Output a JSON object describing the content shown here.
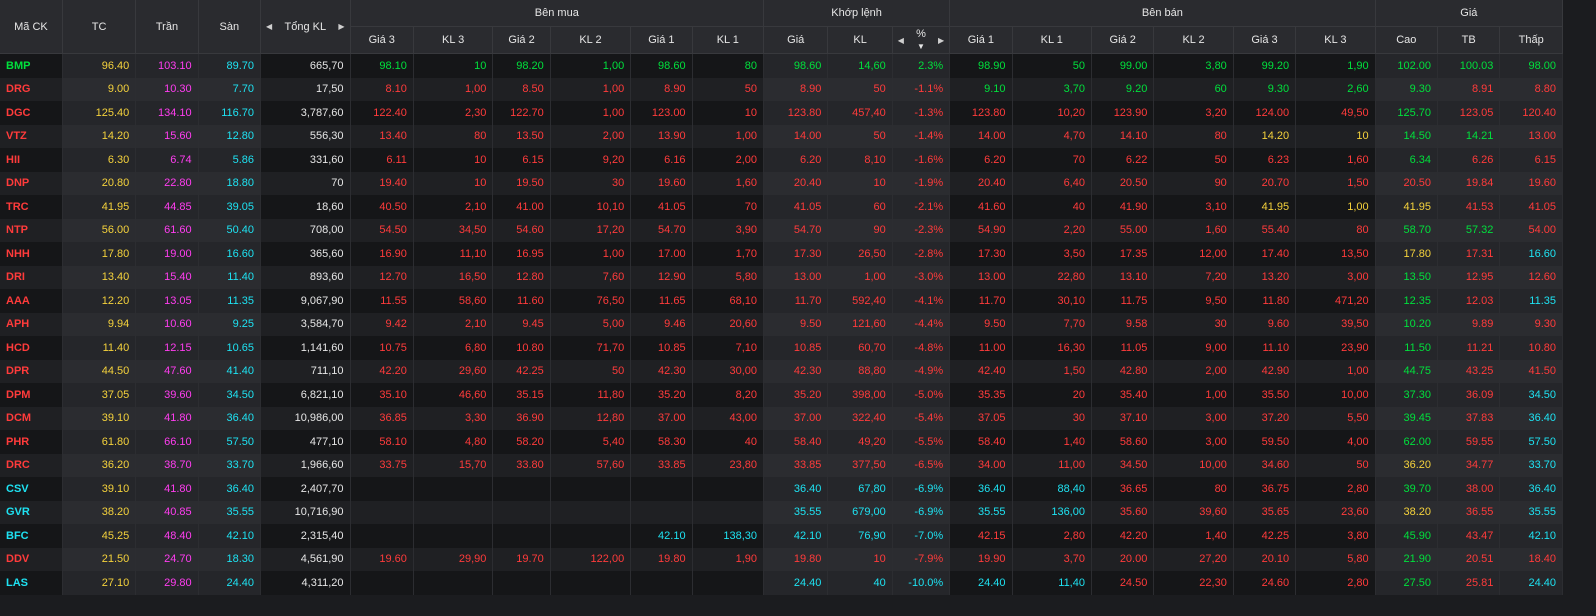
{
  "headers": {
    "symbol": "Mã CK",
    "ref": "TC",
    "ceil": "Trần",
    "floor": "Sàn",
    "total_vol": "Tổng KL",
    "buy_group": "Bên mua",
    "match_group": "Khớp lệnh",
    "sell_group": "Bên bán",
    "price_group": "Giá",
    "buy": [
      "Giá 3",
      "KL 3",
      "Giá 2",
      "KL 2",
      "Giá 1",
      "KL 1"
    ],
    "match": [
      "Giá",
      "KL",
      "%"
    ],
    "sell": [
      "Giá 1",
      "KL 1",
      "Giá 2",
      "KL 2",
      "Giá 3",
      "KL 3"
    ],
    "price": [
      "Cao",
      "TB",
      "Thấp"
    ]
  },
  "colors": {
    "green": "#00e03c",
    "red": "#ff3b3b",
    "yellow": "#f5d23c",
    "purple": "#ff3df0",
    "cyan": "#1ee2f2"
  },
  "rows": [
    {
      "s": "BMP",
      "sc": "green",
      "tc": "96.40",
      "tr": "103.10",
      "sa": "89.70",
      "tk": "665,70",
      "b": [
        "98.10",
        "10",
        "98.20",
        "1,00",
        "98.60",
        "80"
      ],
      "bc": "green",
      "m": [
        "98.60",
        "14,60",
        "2.3%"
      ],
      "mc": "green",
      "se": [
        "98.90",
        "50",
        "99.00",
        "3,80",
        "99.20",
        "1,90"
      ],
      "sec": "green",
      "p": [
        "102.00",
        "100.03",
        "98.00"
      ],
      "pc": [
        "green",
        "green",
        "green"
      ]
    },
    {
      "s": "DRG",
      "sc": "red",
      "tc": "9.00",
      "tr": "10.30",
      "sa": "7.70",
      "tk": "17,50",
      "b": [
        "8.10",
        "1,00",
        "8.50",
        "1,00",
        "8.90",
        "50"
      ],
      "bc": "red",
      "m": [
        "8.90",
        "50",
        "-1.1%"
      ],
      "mc": "red",
      "se": [
        "9.10",
        "3,70",
        "9.20",
        "60",
        "9.30",
        "2,60"
      ],
      "sec": "green",
      "p": [
        "9.30",
        "8.91",
        "8.80"
      ],
      "pc": [
        "green",
        "red",
        "red"
      ]
    },
    {
      "s": "DGC",
      "sc": "red",
      "tc": "125.40",
      "tr": "134.10",
      "sa": "116.70",
      "tk": "3,787,60",
      "b": [
        "122.40",
        "2,30",
        "122.70",
        "1,00",
        "123.00",
        "10"
      ],
      "bc": "red",
      "m": [
        "123.80",
        "457,40",
        "-1.3%"
      ],
      "mc": "red",
      "se": [
        "123.80",
        "10,20",
        "123.90",
        "3,20",
        "124.00",
        "49,50"
      ],
      "sec": "red",
      "p": [
        "125.70",
        "123.05",
        "120.40"
      ],
      "pc": [
        "green",
        "red",
        "red"
      ]
    },
    {
      "s": "VTZ",
      "sc": "red",
      "tc": "14.20",
      "tr": "15.60",
      "sa": "12.80",
      "tk": "556,30",
      "b": [
        "13.40",
        "80",
        "13.50",
        "2,00",
        "13.90",
        "1,00"
      ],
      "bc": "red",
      "m": [
        "14.00",
        "50",
        "-1.4%"
      ],
      "mc": "red",
      "se": [
        "14.00",
        "4,70",
        "14.10",
        "80",
        "14.20",
        "10"
      ],
      "sec": "red",
      "sec_last": "yellow",
      "p": [
        "14.50",
        "14.21",
        "13.00"
      ],
      "pc": [
        "green",
        "green",
        "red"
      ]
    },
    {
      "s": "HII",
      "sc": "red",
      "tc": "6.30",
      "tr": "6.74",
      "sa": "5.86",
      "tk": "331,60",
      "b": [
        "6.11",
        "10",
        "6.15",
        "9,20",
        "6.16",
        "2,00"
      ],
      "bc": "red",
      "m": [
        "6.20",
        "8,10",
        "-1.6%"
      ],
      "mc": "red",
      "se": [
        "6.20",
        "70",
        "6.22",
        "50",
        "6.23",
        "1,60"
      ],
      "sec": "red",
      "p": [
        "6.34",
        "6.26",
        "6.15"
      ],
      "pc": [
        "green",
        "red",
        "red"
      ]
    },
    {
      "s": "DNP",
      "sc": "red",
      "tc": "20.80",
      "tr": "22.80",
      "sa": "18.80",
      "tk": "70",
      "b": [
        "19.40",
        "10",
        "19.50",
        "30",
        "19.60",
        "1,60"
      ],
      "bc": "red",
      "m": [
        "20.40",
        "10",
        "-1.9%"
      ],
      "mc": "red",
      "se": [
        "20.40",
        "6,40",
        "20.50",
        "90",
        "20.70",
        "1,50"
      ],
      "sec": "red",
      "p": [
        "20.50",
        "19.84",
        "19.60"
      ],
      "pc": [
        "red",
        "red",
        "red"
      ]
    },
    {
      "s": "TRC",
      "sc": "red",
      "tc": "41.95",
      "tr": "44.85",
      "sa": "39.05",
      "tk": "18,60",
      "b": [
        "40.50",
        "2,10",
        "41.00",
        "10,10",
        "41.05",
        "70"
      ],
      "bc": "red",
      "m": [
        "41.05",
        "60",
        "-2.1%"
      ],
      "mc": "red",
      "se": [
        "41.60",
        "40",
        "41.90",
        "3,10",
        "41.95",
        "1,00"
      ],
      "sec": "red",
      "sec_last": "yellow",
      "p": [
        "41.95",
        "41.53",
        "41.05"
      ],
      "pc": [
        "yellow",
        "red",
        "red"
      ]
    },
    {
      "s": "NTP",
      "sc": "red",
      "tc": "56.00",
      "tr": "61.60",
      "sa": "50.40",
      "tk": "708,00",
      "b": [
        "54.50",
        "34,50",
        "54.60",
        "17,20",
        "54.70",
        "3,90"
      ],
      "bc": "red",
      "m": [
        "54.70",
        "90",
        "-2.3%"
      ],
      "mc": "red",
      "se": [
        "54.90",
        "2,20",
        "55.00",
        "1,60",
        "55.40",
        "80"
      ],
      "sec": "red",
      "p": [
        "58.70",
        "57.32",
        "54.00"
      ],
      "pc": [
        "green",
        "green",
        "red"
      ]
    },
    {
      "s": "NHH",
      "sc": "red",
      "tc": "17.80",
      "tr": "19.00",
      "sa": "16.60",
      "tk": "365,60",
      "b": [
        "16.90",
        "11,10",
        "16.95",
        "1,00",
        "17.00",
        "1,70"
      ],
      "bc": "red",
      "m": [
        "17.30",
        "26,50",
        "-2.8%"
      ],
      "mc": "red",
      "se": [
        "17.30",
        "3,50",
        "17.35",
        "12,00",
        "17.40",
        "13,50"
      ],
      "sec": "red",
      "p": [
        "17.80",
        "17.31",
        "16.60"
      ],
      "pc": [
        "yellow",
        "red",
        "cyan"
      ]
    },
    {
      "s": "DRI",
      "sc": "red",
      "tc": "13.40",
      "tr": "15.40",
      "sa": "11.40",
      "tk": "893,60",
      "b": [
        "12.70",
        "16,50",
        "12.80",
        "7,60",
        "12.90",
        "5,80"
      ],
      "bc": "red",
      "m": [
        "13.00",
        "1,00",
        "-3.0%"
      ],
      "mc": "red",
      "se": [
        "13.00",
        "22,80",
        "13.10",
        "7,20",
        "13.20",
        "3,00"
      ],
      "sec": "red",
      "p": [
        "13.50",
        "12.95",
        "12.60"
      ],
      "pc": [
        "green",
        "red",
        "red"
      ]
    },
    {
      "s": "AAA",
      "sc": "red",
      "tc": "12.20",
      "tr": "13.05",
      "sa": "11.35",
      "tk": "9,067,90",
      "b": [
        "11.55",
        "58,60",
        "11.60",
        "76,50",
        "11.65",
        "68,10"
      ],
      "bc": "red",
      "m": [
        "11.70",
        "592,40",
        "-4.1%"
      ],
      "mc": "red",
      "se": [
        "11.70",
        "30,10",
        "11.75",
        "9,50",
        "11.80",
        "471,20"
      ],
      "sec": "red",
      "p": [
        "12.35",
        "12.03",
        "11.35"
      ],
      "pc": [
        "green",
        "red",
        "cyan"
      ]
    },
    {
      "s": "APH",
      "sc": "red",
      "tc": "9.94",
      "tr": "10.60",
      "sa": "9.25",
      "tk": "3,584,70",
      "b": [
        "9.42",
        "2,10",
        "9.45",
        "5,00",
        "9.46",
        "20,60"
      ],
      "bc": "red",
      "m": [
        "9.50",
        "121,60",
        "-4.4%"
      ],
      "mc": "red",
      "se": [
        "9.50",
        "7,70",
        "9.58",
        "30",
        "9.60",
        "39,50"
      ],
      "sec": "red",
      "p": [
        "10.20",
        "9.89",
        "9.30"
      ],
      "pc": [
        "green",
        "red",
        "red"
      ]
    },
    {
      "s": "HCD",
      "sc": "red",
      "tc": "11.40",
      "tr": "12.15",
      "sa": "10.65",
      "tk": "1,141,60",
      "b": [
        "10.75",
        "6,80",
        "10.80",
        "71,70",
        "10.85",
        "7,10"
      ],
      "bc": "red",
      "m": [
        "10.85",
        "60,70",
        "-4.8%"
      ],
      "mc": "red",
      "se": [
        "11.00",
        "16,30",
        "11.05",
        "9,00",
        "11.10",
        "23,90"
      ],
      "sec": "red",
      "p": [
        "11.50",
        "11.21",
        "10.80"
      ],
      "pc": [
        "green",
        "red",
        "red"
      ]
    },
    {
      "s": "DPR",
      "sc": "red",
      "tc": "44.50",
      "tr": "47.60",
      "sa": "41.40",
      "tk": "711,10",
      "b": [
        "42.20",
        "29,60",
        "42.25",
        "50",
        "42.30",
        "30,00"
      ],
      "bc": "red",
      "m": [
        "42.30",
        "88,80",
        "-4.9%"
      ],
      "mc": "red",
      "se": [
        "42.40",
        "1,50",
        "42.80",
        "2,00",
        "42.90",
        "1,00"
      ],
      "sec": "red",
      "p": [
        "44.75",
        "43.25",
        "41.50"
      ],
      "pc": [
        "green",
        "red",
        "red"
      ]
    },
    {
      "s": "DPM",
      "sc": "red",
      "tc": "37.05",
      "tr": "39.60",
      "sa": "34.50",
      "tk": "6,821,10",
      "b": [
        "35.10",
        "46,60",
        "35.15",
        "11,80",
        "35.20",
        "8,20"
      ],
      "bc": "red",
      "m": [
        "35.20",
        "398,00",
        "-5.0%"
      ],
      "mc": "red",
      "se": [
        "35.35",
        "20",
        "35.40",
        "1,00",
        "35.50",
        "10,00"
      ],
      "sec": "red",
      "p": [
        "37.30",
        "36.09",
        "34.50"
      ],
      "pc": [
        "green",
        "red",
        "cyan"
      ]
    },
    {
      "s": "DCM",
      "sc": "red",
      "tc": "39.10",
      "tr": "41.80",
      "sa": "36.40",
      "tk": "10,986,00",
      "b": [
        "36.85",
        "3,30",
        "36.90",
        "12,80",
        "37.00",
        "43,00"
      ],
      "bc": "red",
      "m": [
        "37.00",
        "322,40",
        "-5.4%"
      ],
      "mc": "red",
      "se": [
        "37.05",
        "30",
        "37.10",
        "3,00",
        "37.20",
        "5,50"
      ],
      "sec": "red",
      "p": [
        "39.45",
        "37.83",
        "36.40"
      ],
      "pc": [
        "green",
        "red",
        "cyan"
      ]
    },
    {
      "s": "PHR",
      "sc": "red",
      "tc": "61.80",
      "tr": "66.10",
      "sa": "57.50",
      "tk": "477,10",
      "b": [
        "58.10",
        "4,80",
        "58.20",
        "5,40",
        "58.30",
        "40"
      ],
      "bc": "red",
      "m": [
        "58.40",
        "49,20",
        "-5.5%"
      ],
      "mc": "red",
      "se": [
        "58.40",
        "1,40",
        "58.60",
        "3,00",
        "59.50",
        "4,00"
      ],
      "sec": "red",
      "p": [
        "62.00",
        "59.55",
        "57.50"
      ],
      "pc": [
        "green",
        "red",
        "cyan"
      ]
    },
    {
      "s": "DRC",
      "sc": "red",
      "tc": "36.20",
      "tr": "38.70",
      "sa": "33.70",
      "tk": "1,966,60",
      "b": [
        "33.75",
        "15,70",
        "33.80",
        "57,60",
        "33.85",
        "23,80"
      ],
      "bc": "red",
      "m": [
        "33.85",
        "377,50",
        "-6.5%"
      ],
      "mc": "red",
      "se": [
        "34.00",
        "11,00",
        "34.50",
        "10,00",
        "34.60",
        "50"
      ],
      "sec": "red",
      "p": [
        "36.20",
        "34.77",
        "33.70"
      ],
      "pc": [
        "yellow",
        "red",
        "cyan"
      ]
    },
    {
      "s": "CSV",
      "sc": "cyan",
      "tc": "39.10",
      "tr": "41.80",
      "sa": "36.40",
      "tk": "2,407,70",
      "b": [
        "",
        "",
        "",
        "",
        "",
        ""
      ],
      "bc": "red",
      "m": [
        "36.40",
        "67,80",
        "-6.9%"
      ],
      "mc": "cyan",
      "se": [
        "36.40",
        "88,40",
        "36.65",
        "80",
        "36.75",
        "2,80"
      ],
      "sec": "red",
      "sec_first": "cyan",
      "p": [
        "39.70",
        "38.00",
        "36.40"
      ],
      "pc": [
        "green",
        "red",
        "cyan"
      ]
    },
    {
      "s": "GVR",
      "sc": "cyan",
      "tc": "38.20",
      "tr": "40.85",
      "sa": "35.55",
      "tk": "10,716,90",
      "b": [
        "",
        "",
        "",
        "",
        "",
        ""
      ],
      "bc": "red",
      "m": [
        "35.55",
        "679,00",
        "-6.9%"
      ],
      "mc": "cyan",
      "se": [
        "35.55",
        "136,00",
        "35.60",
        "39,60",
        "35.65",
        "23,60"
      ],
      "sec": "red",
      "sec_first": "cyan",
      "p": [
        "38.20",
        "36.55",
        "35.55"
      ],
      "pc": [
        "yellow",
        "red",
        "cyan"
      ]
    },
    {
      "s": "BFC",
      "sc": "cyan",
      "tc": "45.25",
      "tr": "48.40",
      "sa": "42.10",
      "tk": "2,315,40",
      "b": [
        "",
        "",
        "",
        "",
        "42.10",
        "138,30"
      ],
      "bc": "cyan",
      "m": [
        "42.10",
        "76,90",
        "-7.0%"
      ],
      "mc": "cyan",
      "se": [
        "42.15",
        "2,80",
        "42.20",
        "1,40",
        "42.25",
        "3,80"
      ],
      "sec": "red",
      "p": [
        "45.90",
        "43.47",
        "42.10"
      ],
      "pc": [
        "green",
        "red",
        "cyan"
      ]
    },
    {
      "s": "DDV",
      "sc": "red",
      "tc": "21.50",
      "tr": "24.70",
      "sa": "18.30",
      "tk": "4,561,90",
      "b": [
        "19.60",
        "29,90",
        "19.70",
        "122,00",
        "19.80",
        "1,90"
      ],
      "bc": "red",
      "m": [
        "19.80",
        "10",
        "-7.9%"
      ],
      "mc": "red",
      "se": [
        "19.90",
        "3,70",
        "20.00",
        "27,20",
        "20.10",
        "5,80"
      ],
      "sec": "red",
      "p": [
        "21.90",
        "20.51",
        "18.40"
      ],
      "pc": [
        "green",
        "red",
        "red"
      ]
    },
    {
      "s": "LAS",
      "sc": "cyan",
      "tc": "27.10",
      "tr": "29.80",
      "sa": "24.40",
      "tk": "4,311,20",
      "b": [
        "",
        "",
        "",
        "",
        "",
        ""
      ],
      "bc": "red",
      "m": [
        "24.40",
        "40",
        "-10.0%"
      ],
      "mc": "cyan",
      "se": [
        "24.40",
        "11,40",
        "24.50",
        "22,30",
        "24.60",
        "2,80"
      ],
      "sec": "red",
      "sec_first": "cyan",
      "p": [
        "27.50",
        "25.81",
        "24.40"
      ],
      "pc": [
        "green",
        "red",
        "cyan"
      ]
    }
  ]
}
